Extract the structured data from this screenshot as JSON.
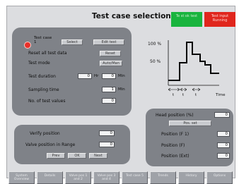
{
  "header": {
    "title": "Test case selection",
    "status_ok": "Te st ok test",
    "status_running": "Test input Running"
  },
  "test_panel": {
    "test_case_label": "Test case 1",
    "select_button": "Select",
    "edit_button": "Edit test",
    "reset_label": "Reset all test data",
    "reset_button": "Reset",
    "test_mode_label": "Test mode",
    "test_mode_button": "Auto/Man",
    "duration_label": "Test duration",
    "duration_h": "0",
    "duration_h_unit": "Hr",
    "duration_min": "0",
    "duration_min_unit": "Min",
    "sampling_label": "Sampling time",
    "sampling_value": "1",
    "sampling_unit": "Min",
    "num_values_label": "No. of test values",
    "num_values_value": "0"
  },
  "graph": {
    "y_label_top": "100 %",
    "y_label_mid": "50 %",
    "x_label_t1": "t",
    "x_label_t2": "t",
    "x_label_t3": "t",
    "x_label_time": "Time"
  },
  "head_panel": {
    "head_position_label": "Head position (%)",
    "head_position_value": "0",
    "head_button": "Pos. set",
    "position_1_label": "Position (F 1)",
    "position_1_value": "0",
    "position_f_label": "Position (F)",
    "position_f_value": "0",
    "position_ext_label": "Position (Ext)",
    "position_ext_value": "0"
  },
  "valve_panel": {
    "verify_label": "Verify position",
    "verify_value": "0",
    "range_label": "Valve position in Range",
    "range_value": "0",
    "btn_prev": "Prev",
    "btn_ok": "OK",
    "btn_next": "Next"
  },
  "nav": [
    {
      "label": "System Overview"
    },
    {
      "label": "Details"
    },
    {
      "label": "Valve pos 1 and 2"
    },
    {
      "label": "Valve pos 3 and 4"
    },
    {
      "label": "Test case 5"
    },
    {
      "label": "Trends"
    },
    {
      "label": "History"
    },
    {
      "label": "Options"
    }
  ]
}
